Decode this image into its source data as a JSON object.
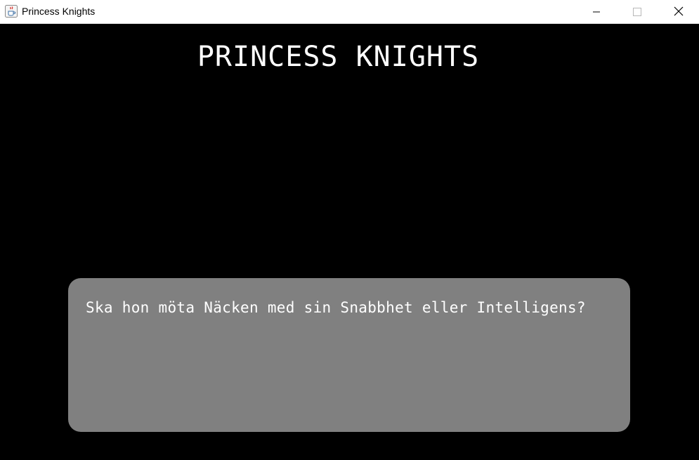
{
  "window": {
    "title": "Princess Knights",
    "icons": {
      "app": "java-coffee-cup-icon",
      "minimize": "minimize-icon",
      "maximize": "maximize-icon",
      "close": "close-icon"
    }
  },
  "game": {
    "title": "PRINCESS KNIGHTS",
    "dialog_text": "Ska hon möta Näcken med sin Snabbhet eller Intelligens?",
    "colors": {
      "background": "#000000",
      "text": "#ffffff",
      "dialog_box": "#808080"
    }
  }
}
